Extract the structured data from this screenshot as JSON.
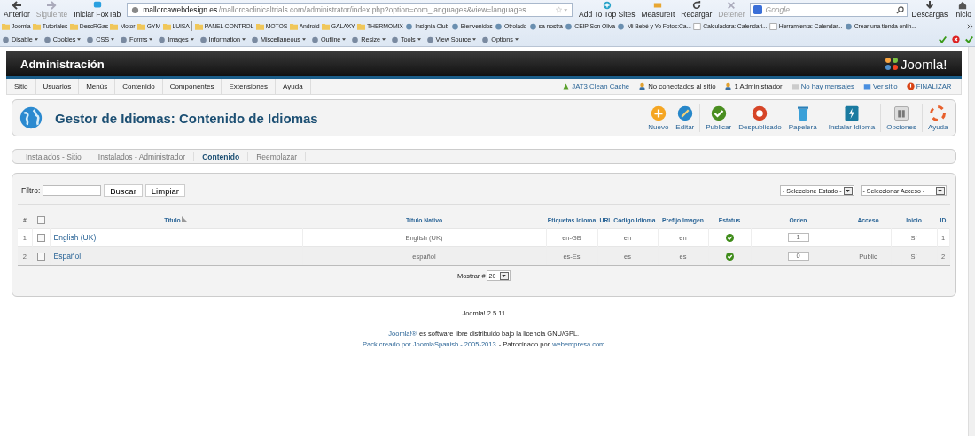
{
  "browser": {
    "nav_buttons": [
      {
        "label": "Anterior",
        "kind": "back",
        "disabled": false
      },
      {
        "label": "Siguiente",
        "kind": "forward",
        "disabled": true
      },
      {
        "label": "Iniciar FoxTab",
        "kind": "foxtab",
        "disabled": false
      }
    ],
    "url": {
      "domain": "mallorcawebdesign.es",
      "path": "/mallorcaclinicaltrials.com/administrator/index.php?option=com_languages&view=languages"
    },
    "tool_buttons": [
      {
        "label": "Add To Top Sites",
        "kind": "plus",
        "disabled": false
      },
      {
        "label": "MeasureIt",
        "kind": "ruler",
        "disabled": false
      },
      {
        "label": "Recargar",
        "kind": "reload",
        "disabled": false
      },
      {
        "label": "Detener",
        "kind": "stop",
        "disabled": true
      }
    ],
    "search": {
      "placeholder": "Google"
    },
    "end_buttons": [
      {
        "label": "Descargas",
        "kind": "download",
        "disabled": false
      },
      {
        "label": "Inicio",
        "kind": "home",
        "disabled": false
      }
    ],
    "bookmarks": [
      {
        "label": "Joomla",
        "kind": "folder"
      },
      {
        "label": "Tutoriales",
        "kind": "folder"
      },
      {
        "label": "DescRGas",
        "kind": "folder"
      },
      {
        "label": "Motor",
        "kind": "folder"
      },
      {
        "label": "GYM",
        "kind": "folder"
      },
      {
        "label": "LUISA",
        "kind": "folder"
      },
      {
        "label": "PANEL CONTROL",
        "kind": "folder"
      },
      {
        "label": "MOTOS",
        "kind": "folder"
      },
      {
        "label": "Android",
        "kind": "folder"
      },
      {
        "label": "GALAXY",
        "kind": "folder"
      },
      {
        "label": "THERMOMIX",
        "kind": "folder"
      },
      {
        "label": "Insignia Club",
        "kind": "site"
      },
      {
        "label": "Bienvenidos",
        "kind": "site"
      },
      {
        "label": "Otrolado",
        "kind": "site"
      },
      {
        "label": "sa nostra",
        "kind": "site"
      },
      {
        "label": "CEIP Son Oliva",
        "kind": "site"
      },
      {
        "label": "Mi Bebé y Yo Fotos:Ca...",
        "kind": "site"
      },
      {
        "label": "Calculadora: Calendari...",
        "kind": "page"
      },
      {
        "label": "Herramienta: Calendar...",
        "kind": "page"
      },
      {
        "label": "Crear una tienda onlin...",
        "kind": "site"
      }
    ],
    "dev_tools": [
      "Disable",
      "Cookies",
      "CSS",
      "Forms",
      "Images",
      "Information",
      "Miscellaneous",
      "Outline",
      "Resize",
      "Tools",
      "View Source",
      "Options"
    ]
  },
  "admin": {
    "title": "Administración",
    "logo": "Joomla!",
    "menu": [
      "Sitio",
      "Usuarios",
      "Menús",
      "Contenido",
      "Componentes",
      "Extensiones",
      "Ayuda"
    ],
    "status": [
      {
        "label": "JAT3 Clean Cache",
        "kind": "cache"
      },
      {
        "label": "No conectados al sitio",
        "kind": "users"
      },
      {
        "label": "1 Administrador",
        "kind": "admin"
      },
      {
        "label": "No hay mensajes",
        "kind": "mail"
      },
      {
        "label": "Ver sitio",
        "kind": "site"
      },
      {
        "label": "FINALIZAR",
        "kind": "logout"
      }
    ],
    "page_title": "Gestor de Idiomas: Contenido de Idiomas",
    "toolbar": [
      {
        "label": "Nuevo",
        "kind": "new",
        "separator_before": false
      },
      {
        "label": "Editar",
        "kind": "edit",
        "separator_before": false
      },
      {
        "label": "Publicar",
        "kind": "publish",
        "separator_before": true
      },
      {
        "label": "Despublicado",
        "kind": "unpublish",
        "separator_before": false
      },
      {
        "label": "Papelera",
        "kind": "trash",
        "separator_before": false
      },
      {
        "label": "Instalar Idioma",
        "kind": "install",
        "separator_before": true
      },
      {
        "label": "Opciones",
        "kind": "options",
        "separator_before": true
      },
      {
        "label": "Ayuda",
        "kind": "help",
        "separator_before": true
      }
    ],
    "subtabs": [
      {
        "label": "Instalados - Sitio",
        "selected": false
      },
      {
        "label": "Instalados - Administrador",
        "selected": false
      },
      {
        "label": "Contenido",
        "selected": true
      },
      {
        "label": "Reemplazar",
        "selected": false
      }
    ],
    "filter": {
      "label": "Filtro:",
      "search_button": "Buscar",
      "clear_button": "Limpiar",
      "state_select": "- Seleccione Estado -",
      "access_select": "- Seleccionar Acceso -"
    },
    "table": {
      "columns": [
        "#",
        "Título",
        "Título Nativo",
        "Etiquetas Idioma",
        "URL Código Idioma",
        "Prefijo Imagen",
        "Estatus",
        "Orden",
        "Acceso",
        "Inicio",
        "ID"
      ],
      "rows": [
        {
          "num": "1",
          "checked": false,
          "title": "English (UK)",
          "native": "English (UK)",
          "tag": "en-GB",
          "url_code": "en",
          "image": "en",
          "published": true,
          "order": "1",
          "home": "Sí",
          "id": "1"
        },
        {
          "num": "2",
          "checked": false,
          "title": "Español",
          "native": "español",
          "tag": "es-Es",
          "url_code": "es",
          "image": "es",
          "published": true,
          "order": "0",
          "access": "Public",
          "home": "Sí",
          "id": "2"
        }
      ],
      "all_checked": false,
      "limit_label": "Mostrar #",
      "limit": "20"
    },
    "footer": {
      "version": "Joomla! 2.5.11",
      "license_link": "Joomla!®",
      "license_text": "es software libre distribuido bajo la licencia GNU/GPL.",
      "pack_link": "Pack creado por JoomlaSpanish - 2005-2013",
      "sponsor_text": "- Patrocinado por",
      "sponsor_link": "webempresa.com"
    }
  }
}
